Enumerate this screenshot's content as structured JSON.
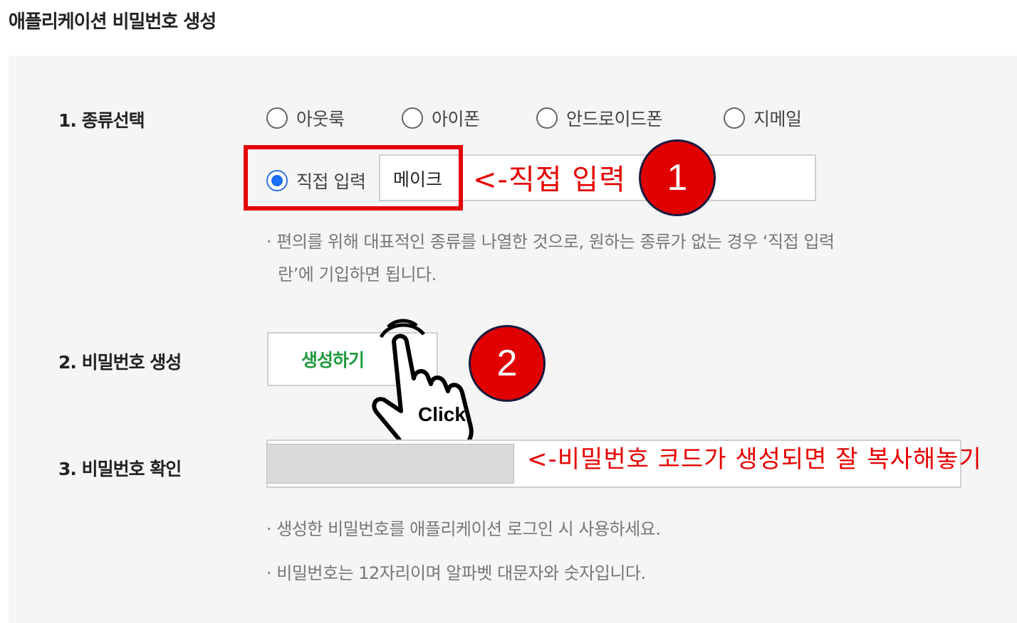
{
  "page": {
    "title": "애플리케이션 비밀번호 생성"
  },
  "type_select": {
    "label": "1. 종류선택",
    "options": [
      "아웃룩",
      "아이폰",
      "안드로이드폰",
      "지메일"
    ],
    "custom_option": "직접 입력",
    "custom_value": "메이크",
    "note_line1": "· 편의를 위해 대표적인 종류를 나열한 것으로, 원하는 종류가 없는 경우 ‘직접 입력",
    "note_line2": "란’에 기입하면 됩니다."
  },
  "generate": {
    "label": "2. 비밀번호 생성",
    "button": "생성하기"
  },
  "confirm": {
    "label": "3. 비밀번호 확인",
    "note1": "· 생성한 비밀번호를 애플리케이션 로그인 시 사용하세요.",
    "note2": "· 비밀번호는 12자리이며 알파벳 대문자와 숫자입니다."
  },
  "annotations": {
    "step1_text": "<-직접 입력",
    "step1_number": "1",
    "step2_number": "2",
    "click_text": "Click",
    "copy_text": "<-비밀번호 코드가 생성되면 잘 복사해놓기"
  },
  "colors": {
    "accent_red": "#e60000",
    "radio_blue": "#1a6df5",
    "button_green": "#1f9a3c",
    "panel_bg": "#f5f5f5"
  }
}
